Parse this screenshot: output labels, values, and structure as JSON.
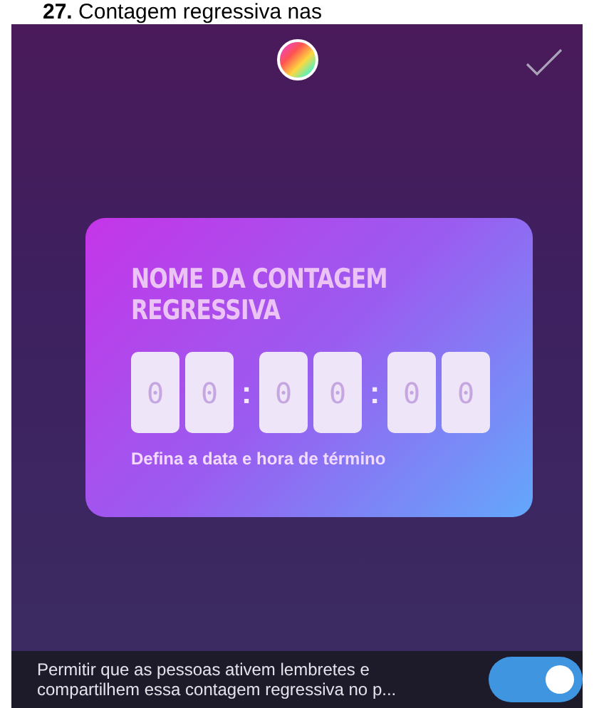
{
  "caption": {
    "number": "27.",
    "text": "Contagem regressiva nas"
  },
  "card": {
    "title": "NOME DA CONTAGEM REGRESSIVA",
    "digits": [
      "0",
      "0",
      "0",
      "0",
      "0",
      "0"
    ],
    "separator": ":",
    "hint": "Defina a data e hora de término"
  },
  "reminder": {
    "text": "Permitir que as pessoas ativem lembretes e compartilhem essa contagem regressiva no p...",
    "on": true
  }
}
